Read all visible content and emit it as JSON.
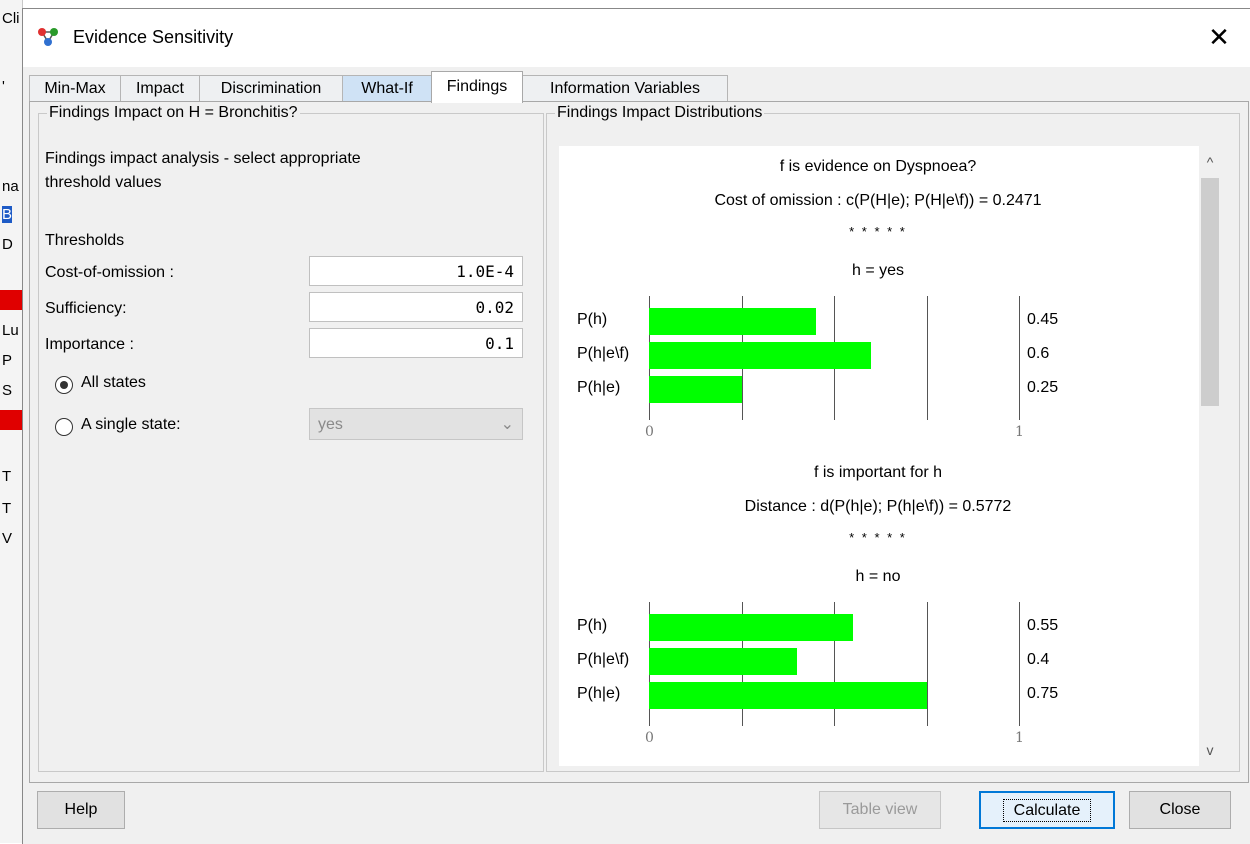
{
  "background_fragments": [
    "Cli",
    "'",
    "na",
    "B",
    "D",
    "Lu",
    "P",
    "S",
    "T",
    "T",
    "V"
  ],
  "window": {
    "title": "Evidence Sensitivity",
    "close_glyph": "✕"
  },
  "tabs": [
    {
      "label": "Min-Max",
      "state": "normal"
    },
    {
      "label": "Impact",
      "state": "normal"
    },
    {
      "label": "Discrimination",
      "state": "normal"
    },
    {
      "label": "What-If",
      "state": "hover"
    },
    {
      "label": "Findings",
      "state": "active"
    },
    {
      "label": "Information Variables",
      "state": "normal"
    }
  ],
  "left_panel": {
    "legend": "Findings Impact on H = Bronchitis?",
    "description_line1": "Findings impact analysis - select appropriate",
    "description_line2": "threshold values",
    "thresholds_heading": "Thresholds",
    "fields": [
      {
        "label": "Cost-of-omission :",
        "value": "1.0E-4"
      },
      {
        "label": "Sufficiency:",
        "value": "0.02"
      },
      {
        "label": "Importance :",
        "value": "0.1"
      }
    ],
    "radio_all_states": {
      "label": "All states",
      "selected": true
    },
    "radio_single_state": {
      "label": "A single state:",
      "selected": false
    },
    "state_select": {
      "value": "yes",
      "disabled": true
    }
  },
  "right_panel": {
    "legend": "Findings Impact Distributions",
    "scroll_up_glyph": "^",
    "scroll_down_glyph": "v"
  },
  "chart_data": [
    {
      "type": "bar",
      "orientation": "horizontal",
      "header_line1": "f is evidence on Dyspnoea?",
      "header_line2": "Cost of omission : c(P(H|e); P(H|e\\f)) = 0.2471",
      "separator": "* * * * *",
      "title": "h = yes",
      "categories": [
        "P(h)",
        "P(h|e\\f)",
        "P(h|e)"
      ],
      "values": [
        0.45,
        0.6,
        0.25
      ],
      "value_labels": [
        "0.45",
        "0.6",
        "0.25"
      ],
      "xlim": [
        0,
        1
      ],
      "xtick_labels": [
        "0",
        "1"
      ],
      "grid": true,
      "bar_color": "#00ff00"
    },
    {
      "type": "bar",
      "orientation": "horizontal",
      "header_line1": "f is important for h",
      "header_line2": "Distance : d(P(h|e); P(h|e\\f)) = 0.5772",
      "separator": "* * * * *",
      "title": "h = no",
      "categories": [
        "P(h)",
        "P(h|e\\f)",
        "P(h|e)"
      ],
      "values": [
        0.55,
        0.4,
        0.75
      ],
      "value_labels": [
        "0.55",
        "0.4",
        "0.75"
      ],
      "xlim": [
        0,
        1
      ],
      "xtick_labels": [
        "0",
        "1"
      ],
      "grid": true,
      "bar_color": "#00ff00"
    }
  ],
  "buttons": {
    "help": "Help",
    "table_view": "Table view",
    "calculate": "Calculate",
    "close": "Close"
  }
}
